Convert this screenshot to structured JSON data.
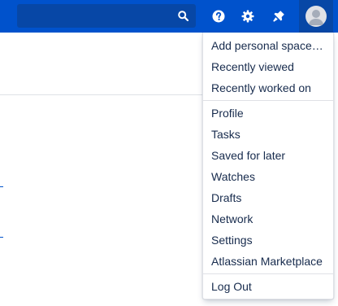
{
  "header": {
    "search": {
      "placeholder": "",
      "value": ""
    },
    "icons": {
      "search": "search-icon",
      "help": "help-icon",
      "settings": "gear-icon",
      "notifications": "notification-icon",
      "profile": "avatar"
    }
  },
  "profile_menu": {
    "sections": [
      {
        "items": [
          "Add personal space…",
          "Recently viewed",
          "Recently worked on"
        ]
      },
      {
        "items": [
          "Profile",
          "Tasks",
          "Saved for later",
          "Watches",
          "Drafts",
          "Network",
          "Settings",
          "Atlassian Marketplace"
        ]
      },
      {
        "items": [
          "Log Out"
        ]
      }
    ]
  },
  "colors": {
    "header_bg": "#0052cc",
    "header_dark": "#0747a6",
    "text": "#172b4d",
    "separator": "#dfe1e6"
  }
}
